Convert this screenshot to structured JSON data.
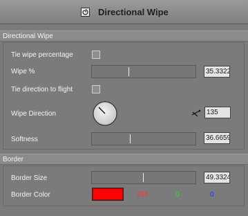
{
  "window": {
    "title": "Directional Wipe",
    "icon": "swirl-icon"
  },
  "directional_wipe": {
    "header": "Directional Wipe",
    "tie_wipe_percentage": {
      "label": "Tie wipe percentage",
      "checked": false
    },
    "wipe_percent": {
      "label": "Wipe %",
      "value": "35.3322",
      "fraction": 0.353
    },
    "tie_direction": {
      "label": "Tie direction to flight",
      "checked": false
    },
    "wipe_direction": {
      "label": "Wipe Direction",
      "value": "135",
      "icon": "flight-path-icon"
    },
    "softness": {
      "label": "Softness",
      "value": "36.6659",
      "fraction": 0.367
    }
  },
  "border": {
    "header": "Border",
    "border_size": {
      "label": "Border Size",
      "value": "49.3324",
      "fraction": 0.493
    },
    "border_color": {
      "label": "Border Color",
      "swatch": "#fb0404",
      "r": "255",
      "g": "0",
      "b": "0",
      "r_color": "#ff3030",
      "g_color": "#33dd33",
      "b_color": "#2233ff"
    }
  }
}
